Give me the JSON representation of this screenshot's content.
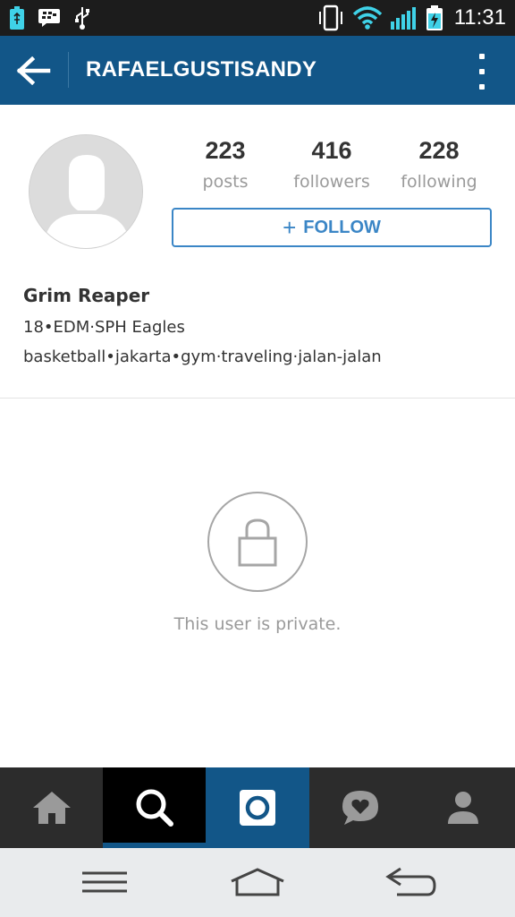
{
  "status_bar": {
    "time": "11:31",
    "icons": [
      "battery-charging-icon",
      "bbm-icon",
      "usb-icon",
      "vibrate-icon",
      "wifi-icon",
      "signal-icon",
      "battery-icon"
    ]
  },
  "header": {
    "username": "RAFAELGUSTISANDY",
    "back_icon": "arrow-left-icon",
    "menu_icon": "vertical-dots-icon"
  },
  "profile": {
    "avatar": "default-avatar-icon",
    "stats": [
      {
        "value": "223",
        "label": "posts"
      },
      {
        "value": "416",
        "label": "followers"
      },
      {
        "value": "228",
        "label": "following"
      }
    ],
    "follow_button": {
      "plus": "+",
      "label": "FOLLOW"
    },
    "bio": {
      "name": "Grim Reaper",
      "line1": "18•EDM·SPH Eagles",
      "line2": "basketball•jakarta•gym·traveling·jalan-jalan"
    }
  },
  "private": {
    "icon": "lock-icon",
    "message": "This user is private."
  },
  "tabs": [
    {
      "name": "home",
      "icon": "home-icon"
    },
    {
      "name": "search",
      "icon": "search-icon",
      "active": true
    },
    {
      "name": "camera",
      "icon": "camera-icon"
    },
    {
      "name": "activity",
      "icon": "heart-bubble-icon"
    },
    {
      "name": "profile",
      "icon": "person-icon"
    }
  ],
  "nav": [
    "menu-icon",
    "home-outline-icon",
    "back-icon"
  ],
  "colors": {
    "brand": "#125688",
    "follow": "#3b86c6",
    "muted": "#9a9a9a"
  }
}
